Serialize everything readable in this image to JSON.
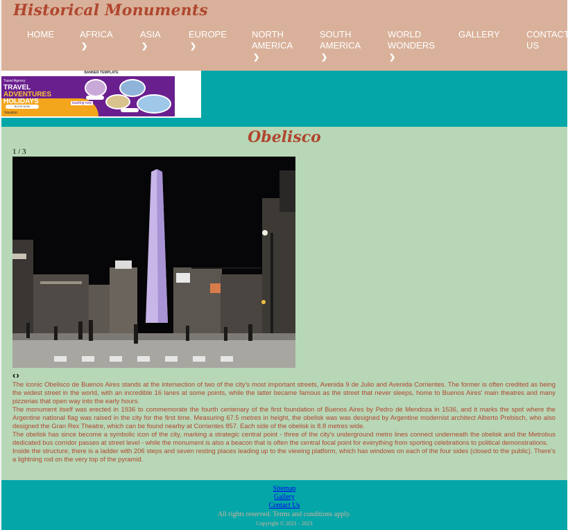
{
  "header": {
    "site_title": "Historical Monuments",
    "nav": [
      {
        "line1": "HOME",
        "line2": "",
        "chevron": false
      },
      {
        "line1": "AFRICA",
        "line2": "",
        "chevron": true
      },
      {
        "line1": "ASIA",
        "line2": "",
        "chevron": true
      },
      {
        "line1": "EUROPE",
        "line2": "",
        "chevron": true
      },
      {
        "line1": "NORTH",
        "line2": "AMERICA",
        "chevron": true
      },
      {
        "line1": "SOUTH",
        "line2": "AMERICA",
        "chevron": true
      },
      {
        "line1": "WORLD",
        "line2": "WONDERS",
        "chevron": true
      },
      {
        "line1": "GALLERY",
        "line2": "",
        "chevron": false
      },
      {
        "line1": "CONTACT",
        "line2": "US",
        "chevron": false
      }
    ],
    "chevron_glyph": "❯"
  },
  "banner": {
    "top_text": "BANNER TEMPLATE",
    "small_text": "Travel Agency",
    "headline_1": "TRAVEL",
    "headline_2": "ADVENTURES",
    "headline_3": "HOLIDAYS",
    "button_text": "BOOK NOW",
    "bottom_text": "Vacation",
    "script_text": "booking now"
  },
  "main": {
    "title": "Obelisco",
    "counter": "1 / 3",
    "prev_glyph": "‹",
    "next_glyph": "›",
    "paragraphs": [
      "The iconic Obelisco de Buenos Aires stands at the intersection of two of the city's most important streets, Avenida 9 de Julio and Avenida Corrientes. The former is often credited as being the widest street in the world, with an incredible 16 lanes at some points, while the latter became famous as the street that never sleeps, home to Buenos Aires' main theatres and many pizzerias that open way into the early hours.",
      "The monument itself was erected in 1936 to commemorate the fourth centenary of the first foundation of Buenos Aires by Pedro de Mendoza in 1536, and it marks the spot where the Argentine national flag was raised in the city for the first time. Measuring 67.5 metres in height, the obelisk was was designed by Argentine modernist architect Alberto Prebisch, who also designed the Gran Rex Theatre, which can be found nearby at Corrientes 857. Each side of the obelisk is 8.8 metres wide.",
      "The obelisk has since become a symbolic icon of the city, marking a strategic central point - three of the city's underground metro lines connect underneath the obelisk and the Metrobus dedicated bus corridor passes at street level - while the monument is also a beacon that is often the central focal point for everything from sporting celebrations to political demonstrations.",
      "Inside the structure, there is a ladder with 206 steps and seven resting places leading up to the viewing platform, which has windows on each of the four sides (closed to the public). There's a lightning rod on the very top of the pyramid."
    ]
  },
  "footer": {
    "links": [
      "Sitemap",
      "Gallery",
      "Contact Us"
    ],
    "rights": "All rights reserved. Terms and conditions apply.",
    "copyright": "Copyright © 2021 - 2023"
  },
  "colors": {
    "header_bg": "#d9b19a",
    "accent_teal": "#04a6a8",
    "main_bg": "#b7d7b6",
    "title_red": "#b0462f"
  }
}
